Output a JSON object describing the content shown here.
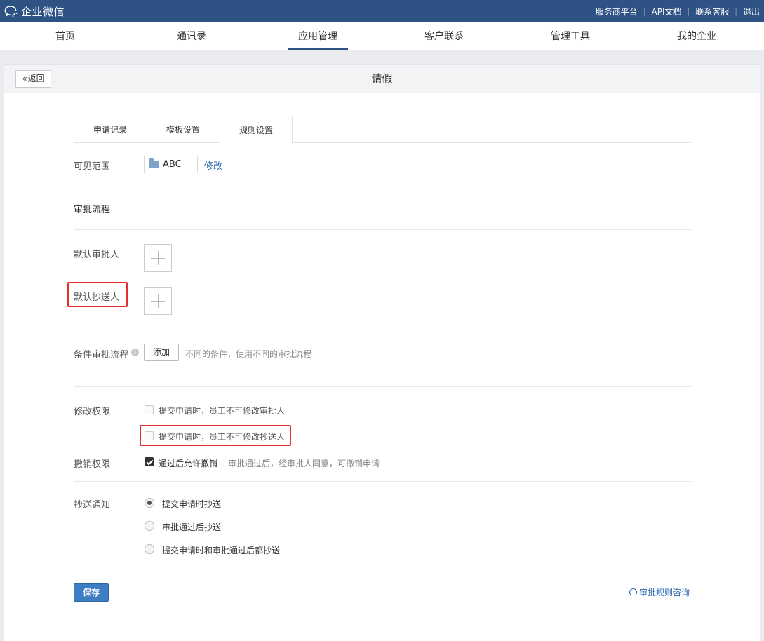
{
  "topbar": {
    "logo_text": "企业微信",
    "links": [
      "服务商平台",
      "API文档",
      "联系客服",
      "退出"
    ]
  },
  "nav": {
    "items": [
      "首页",
      "通讯录",
      "应用管理",
      "客户联系",
      "管理工具",
      "我的企业"
    ],
    "active": "应用管理"
  },
  "panel": {
    "back_label": "返回",
    "title": "请假"
  },
  "tabs": {
    "items": [
      "申请记录",
      "模板设置",
      "规则设置"
    ],
    "active": "规则设置"
  },
  "visibility": {
    "label": "可见范围",
    "value": "ABC",
    "edit_label": "修改"
  },
  "approval_flow": {
    "heading": "审批流程",
    "default_approver_label": "默认审批人",
    "default_cc_label": "默认抄送人",
    "conditional_label": "条件审批流程",
    "add_label": "添加",
    "conditional_hint": "不同的条件，使用不同的审批流程"
  },
  "edit_permission": {
    "label": "修改权限",
    "option1": "提交申请时，员工不可修改审批人",
    "option2": "提交申请时，员工不可修改抄送人"
  },
  "revoke_permission": {
    "label": "撤销权限",
    "option": "通过后允许撤销",
    "hint": "审批通过后，经审批人同意，可撤销申请"
  },
  "cc_notify": {
    "label": "抄送通知",
    "options": [
      "提交申请时抄送",
      "审批通过后抄送",
      "提交申请时和审批通过后都抄送"
    ],
    "selected": "提交申请时抄送"
  },
  "footer": {
    "save_label": "保存",
    "consult_label": "审批规则咨询"
  },
  "colors": {
    "topbar": "#2f5284",
    "accent_link": "#2f6ab3",
    "save_button": "#3d7dc4",
    "highlight": "#e62e2e"
  }
}
